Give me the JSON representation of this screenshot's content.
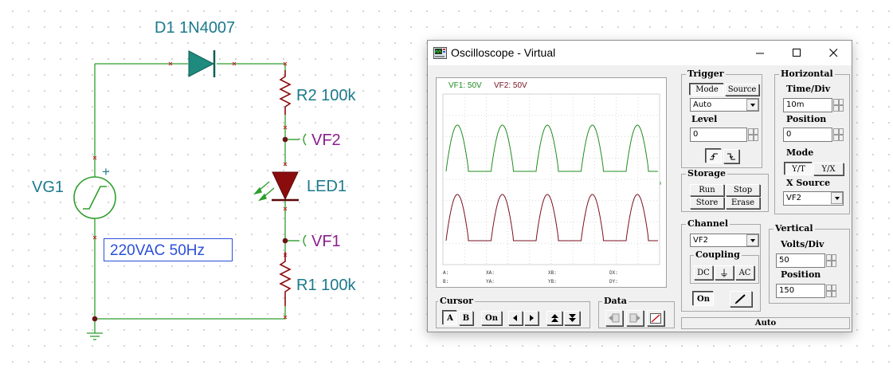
{
  "schematic": {
    "diode_label": "D1 1N4007",
    "r2_label": "R2 100k",
    "vf2_label": "VF2",
    "led_label": "LED1",
    "vf1_label": "VF1",
    "r1_label": "R1 100k",
    "source_label": "VG1",
    "source_plus": "+",
    "source_value": "220VAC 50Hz",
    "colors": {
      "wire": "#2e9e2e",
      "diode": "#1f8a7e",
      "led": "#8b0c0c",
      "label": "#1c7a8c",
      "probe": "#8b1f8e",
      "junction": "#6b1414"
    }
  },
  "window": {
    "title": "Oscilloscope - Virtual",
    "controls": {
      "minimize": "minimize-icon",
      "maximize": "maximize-icon",
      "close": "close-icon"
    }
  },
  "screen": {
    "legend_vf1": "VF1: 50V",
    "legend_vf2": "VF2: 50V",
    "readouts": {
      "a": "A:",
      "b": "B:",
      "xa": "XA:",
      "ya": "YA:",
      "xb": "XB:",
      "yb": "YB:",
      "dx": "DX:",
      "dy": "DY:"
    },
    "trace_colors": {
      "vf1": "#7a1020",
      "vf2": "#1f8c1f"
    }
  },
  "trigger": {
    "title": "Trigger",
    "mode_label": "Mode",
    "source_label": "Source",
    "mode_value": "Auto",
    "level_label": "Level",
    "level_value": "0",
    "edge_rising": "rising-edge-icon",
    "edge_falling": "falling-edge-icon"
  },
  "storage": {
    "title": "Storage",
    "run": "Run",
    "stop": "Stop",
    "store": "Store",
    "erase": "Erase"
  },
  "channel": {
    "title": "Channel",
    "value": "VF2",
    "coupling_title": "Coupling",
    "dc": "DC",
    "gnd": "⏚",
    "ac": "AC",
    "on": "On",
    "pen_icon": "pen-icon"
  },
  "horizontal": {
    "title": "Horizontal",
    "timediv_label": "Time/Div",
    "timediv_value": "10m",
    "position_label": "Position",
    "position_value": "0",
    "mode_label": "Mode",
    "yt": "Y/T",
    "yx": "Y/X",
    "xsource_label": "X Source",
    "xsource_value": "VF2"
  },
  "vertical": {
    "title": "Vertical",
    "voltsdiv_label": "Volts/Div",
    "voltsdiv_value": "50",
    "position_label": "Position",
    "position_value": "150"
  },
  "cursor": {
    "title": "Cursor",
    "a": "A",
    "b": "B",
    "on": "On"
  },
  "data": {
    "title": "Data"
  },
  "status": "Auto"
}
